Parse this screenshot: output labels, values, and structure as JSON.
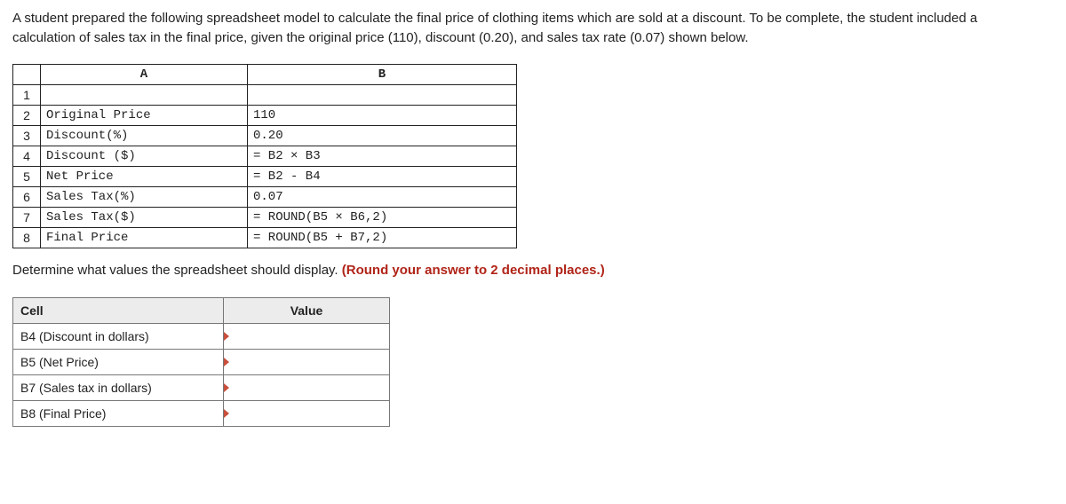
{
  "intro": "A student prepared the following spreadsheet model to calculate the final price of clothing items which are sold at a discount. To be complete, the student included a calculation of sales tax in the final price, given the original price (110), discount (0.20), and sales tax rate (0.07) shown below.",
  "spreadsheet": {
    "colA": "A",
    "colB": "B",
    "rows": [
      {
        "n": "1",
        "a": "",
        "b": ""
      },
      {
        "n": "2",
        "a": "Original Price",
        "b": "110"
      },
      {
        "n": "3",
        "a": "Discount(%)",
        "b": "0.20"
      },
      {
        "n": "4",
        "a": "Discount ($)",
        "b": "= B2 × B3"
      },
      {
        "n": "5",
        "a": "Net Price",
        "b": "= B2 - B4"
      },
      {
        "n": "6",
        "a": "Sales Tax(%)",
        "b": "0.07"
      },
      {
        "n": "7",
        "a": "Sales Tax($)",
        "b": "= ROUND(B5 × B6,2)"
      },
      {
        "n": "8",
        "a": "Final Price",
        "b": "= ROUND(B5 + B7,2)"
      }
    ]
  },
  "prompt_text": "Determine what values the spreadsheet should display. ",
  "hint_text": "(Round your answer to 2 decimal places.)",
  "answer_table": {
    "header_cell": "Cell",
    "header_value": "Value",
    "rows": [
      {
        "cell": "B4 (Discount in dollars)"
      },
      {
        "cell": "B5 (Net Price)"
      },
      {
        "cell": "B7 (Sales tax in dollars)"
      },
      {
        "cell": "B8 (Final Price)"
      }
    ]
  }
}
